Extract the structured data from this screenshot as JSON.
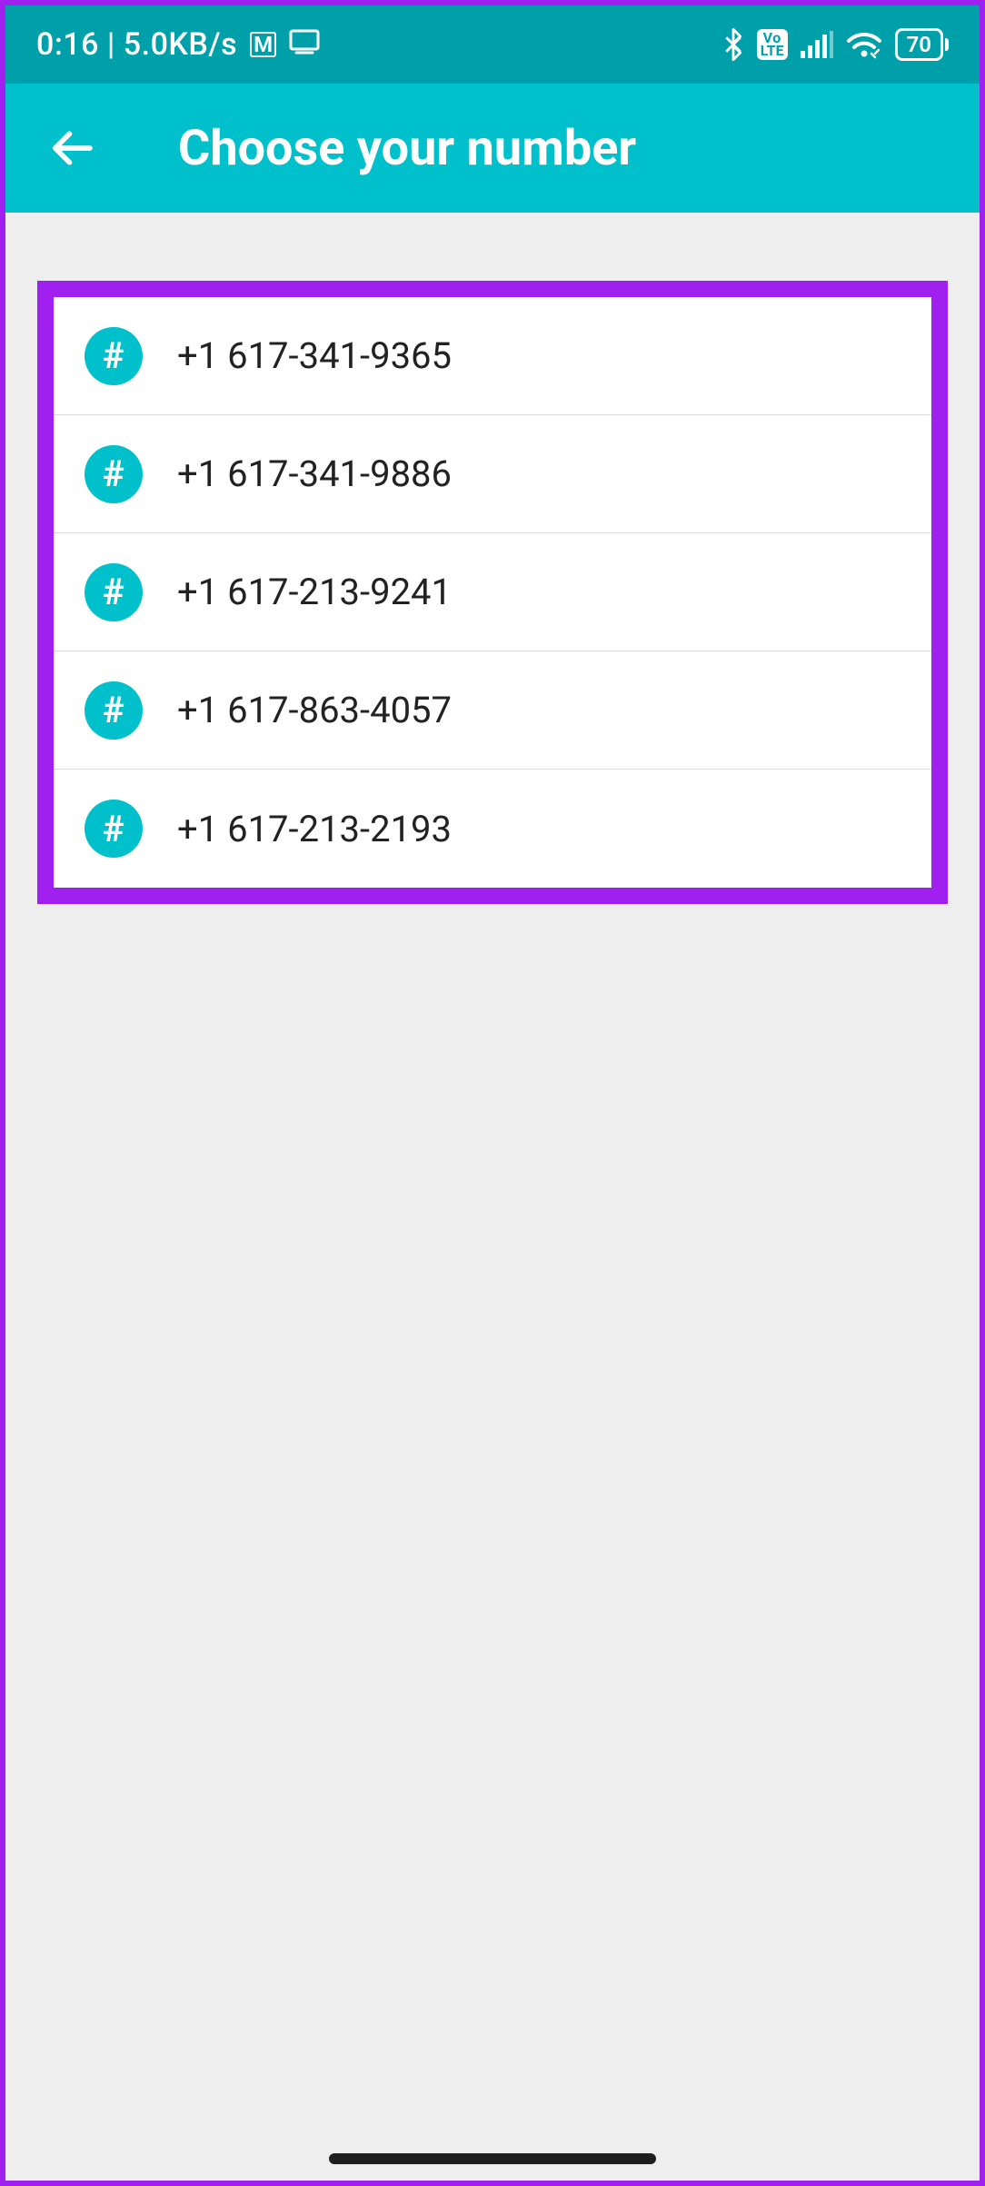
{
  "status": {
    "time": "0:16",
    "net_speed": "5.0KB/s",
    "volte_top": "Vo",
    "volte_bottom": "LTE",
    "battery_pct": "70"
  },
  "appbar": {
    "title": "Choose your number"
  },
  "numbers": [
    "+1 617-341-9365",
    "+1 617-341-9886",
    "+1 617-213-9241",
    "+1 617-863-4057",
    "+1 617-213-2193"
  ],
  "icons": {
    "hash": "#"
  }
}
